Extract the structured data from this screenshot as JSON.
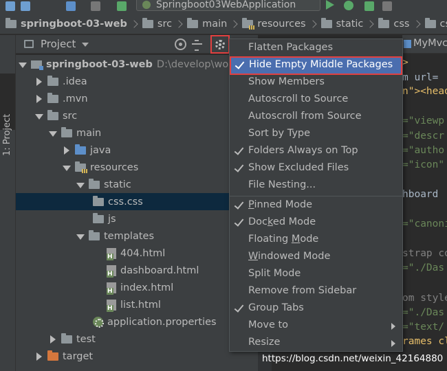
{
  "toolbar": {
    "run_configuration": "Springboot03WebApplication"
  },
  "breadcrumb": {
    "items": [
      {
        "label": "springboot-03-web",
        "icon": "module-folder-icon"
      },
      {
        "label": "src",
        "icon": "folder-icon"
      },
      {
        "label": "main",
        "icon": "folder-icon"
      },
      {
        "label": "resources",
        "icon": "resources-folder-icon"
      },
      {
        "label": "static",
        "icon": "folder-icon"
      },
      {
        "label": "css",
        "icon": "folder-icon"
      },
      {
        "label": "css",
        "icon": "folder-icon"
      }
    ]
  },
  "side_strip": {
    "tab_label": "1: Project"
  },
  "project_panel": {
    "title": "Project"
  },
  "tree": {
    "items": [
      {
        "label": "springboot-03-web",
        "path": "D:\\develop\\work",
        "icon": "module-folder-icon",
        "state": "expanded"
      },
      {
        "label": ".idea",
        "icon": "folder-icon",
        "state": "collapsed"
      },
      {
        "label": ".mvn",
        "icon": "folder-icon",
        "state": "collapsed"
      },
      {
        "label": "src",
        "icon": "folder-icon",
        "state": "expanded"
      },
      {
        "label": "main",
        "icon": "folder-icon",
        "state": "expanded"
      },
      {
        "label": "java",
        "icon": "source-folder-icon",
        "state": "collapsed"
      },
      {
        "label": "resources",
        "icon": "resources-folder-icon",
        "state": "expanded"
      },
      {
        "label": "static",
        "icon": "folder-icon",
        "state": "expanded"
      },
      {
        "label": "css.css",
        "icon": "folder-icon",
        "state": "leaf",
        "selected": true
      },
      {
        "label": "js",
        "icon": "folder-icon",
        "state": "leaf"
      },
      {
        "label": "templates",
        "icon": "folder-icon",
        "state": "expanded"
      },
      {
        "label": "404.html",
        "icon": "html-file-icon",
        "state": "leaf"
      },
      {
        "label": "dashboard.html",
        "icon": "html-file-icon",
        "state": "leaf"
      },
      {
        "label": "index.html",
        "icon": "html-file-icon",
        "state": "leaf"
      },
      {
        "label": "list.html",
        "icon": "html-file-icon",
        "state": "leaf"
      },
      {
        "label": "application.properties",
        "icon": "properties-file-icon",
        "state": "leaf"
      },
      {
        "label": "test",
        "icon": "folder-icon",
        "state": "collapsed"
      },
      {
        "label": "target",
        "icon": "excluded-folder-icon",
        "state": "collapsed"
      }
    ]
  },
  "editor": {
    "tab_label": "MyMvc",
    "lines": [
      {
        "text": ">",
        "kind": "tag"
      },
      {
        "text": "m url=",
        "kind": "txt"
      },
      {
        "text": "n\"><head",
        "kind": "tag"
      },
      {
        "text": "",
        "kind": "txt"
      },
      {
        "text": "=\"viewp",
        "kind": "str"
      },
      {
        "text": "=\"descr",
        "kind": "str"
      },
      {
        "text": "=\"autho",
        "kind": "str"
      },
      {
        "text": "=\"icon\"",
        "kind": "str"
      },
      {
        "text": "",
        "kind": "txt"
      },
      {
        "text": "hboard",
        "kind": "txt"
      },
      {
        "text": "",
        "kind": "txt"
      },
      {
        "text": "=\"canoni",
        "kind": "str"
      },
      {
        "text": "",
        "kind": "txt"
      },
      {
        "text": "strap co",
        "kind": "cmt"
      },
      {
        "text": "=\"./Das",
        "kind": "str"
      },
      {
        "text": "",
        "kind": "txt"
      },
      {
        "text": "om style",
        "kind": "cmt"
      },
      {
        "text": "=\"./Das",
        "kind": "str"
      },
      {
        "text": "=\"text/",
        "kind": "str"
      },
      {
        "text": "rames cl",
        "kind": "tag"
      }
    ]
  },
  "menu": {
    "items": [
      {
        "label": "Flatten Packages",
        "checked": false
      },
      {
        "label": "Hide Empty Middle Packages",
        "checked": true,
        "highlighted": true
      },
      {
        "label": "Show Members",
        "checked": false
      },
      {
        "label": "Autoscroll to Source",
        "checked": false
      },
      {
        "label": "Autoscroll from Source",
        "checked": false
      },
      {
        "label": "Sort by Type",
        "checked": false
      },
      {
        "label": "Folders Always on Top",
        "checked": true
      },
      {
        "label": "Show Excluded Files",
        "checked": true
      },
      {
        "label": "File Nesting...",
        "checked": false
      },
      {
        "separator": true
      },
      {
        "label": "Pinned Mode",
        "checked": true,
        "mnemonic": "P"
      },
      {
        "label": "Docked Mode",
        "checked": true,
        "mnemonic": "k"
      },
      {
        "label": "Floating Mode",
        "checked": false,
        "mnemonic": "M"
      },
      {
        "label": "Windowed Mode",
        "checked": false,
        "mnemonic": "W"
      },
      {
        "label": "Split Mode",
        "checked": false
      },
      {
        "label": "Remove from Sidebar",
        "checked": false
      },
      {
        "label": "Group Tabs",
        "checked": true
      },
      {
        "label": "Move to",
        "checked": false,
        "submenu": true
      },
      {
        "label": "Resize",
        "checked": false,
        "submenu": true
      }
    ]
  },
  "watermark": "https://blog.csdn.net/weixin_42164880",
  "colors": {
    "background": "#2b2b2b",
    "panel": "#3c3f41",
    "selection": "#0d293e",
    "menu_highlight": "#4b6eaf",
    "annotation_red": "#e24040"
  }
}
